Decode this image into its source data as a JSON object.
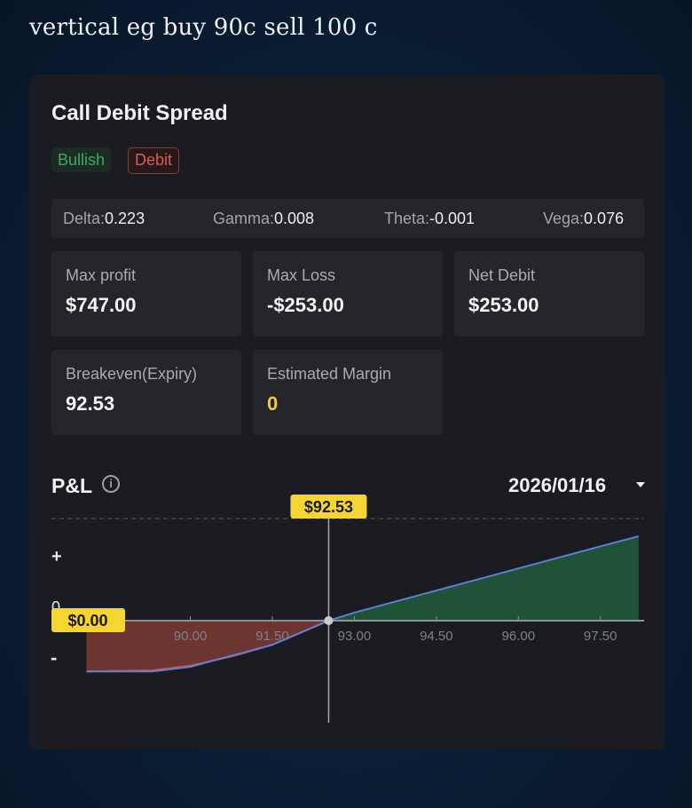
{
  "caption": "vertical eg buy 90c sell 100 c",
  "card": {
    "title": "Call Debit Spread",
    "tags": [
      "Bullish",
      "Debit"
    ],
    "greeks": [
      {
        "label": "Delta:",
        "value": "0.223"
      },
      {
        "label": "Gamma:",
        "value": "0.008"
      },
      {
        "label": "Theta:",
        "value": "-0.001"
      },
      {
        "label": "Vega:",
        "value": "0.076"
      }
    ],
    "metrics": [
      {
        "label": "Max profit",
        "value": "$747.00"
      },
      {
        "label": "Max Loss",
        "value": "-$253.00"
      },
      {
        "label": "Net Debit",
        "value": "$253.00"
      },
      {
        "label": "Breakeven(Expiry)",
        "value": "92.53"
      },
      {
        "label": "Estimated Margin",
        "value": "0"
      }
    ]
  },
  "pnl": {
    "title": "P&L",
    "date": "2026/01/16",
    "info_icon": "info-icon",
    "dropdown_icon": "caret-down-icon",
    "cursor_label": "$92.53",
    "zero_label": "$0.00",
    "axis_signs": {
      "plus": "+",
      "zero": "0",
      "minus": "-"
    }
  },
  "colors": {
    "profit_fill": "#1f5236",
    "loss_fill": "#7a3a33",
    "line": "#5b7fd6",
    "expiry_line": "#e0573f",
    "label_bg": "#f5d531"
  },
  "chart_data": {
    "type": "area",
    "x_ticks": [
      "90.00",
      "91.50",
      "93.00",
      "94.50",
      "96.00",
      "97.50"
    ],
    "breakeven": 92.53,
    "x": [
      88.1,
      89.3,
      90.0,
      91.5,
      92.53,
      93.0,
      94.5,
      96.0,
      97.5,
      98.2
    ],
    "series": [
      {
        "values": [
          -253,
          -253,
          -230,
          -120,
          0,
          40,
          150,
          260,
          370,
          420
        ]
      }
    ],
    "xlim": [
      87.8,
      98.3
    ]
  }
}
